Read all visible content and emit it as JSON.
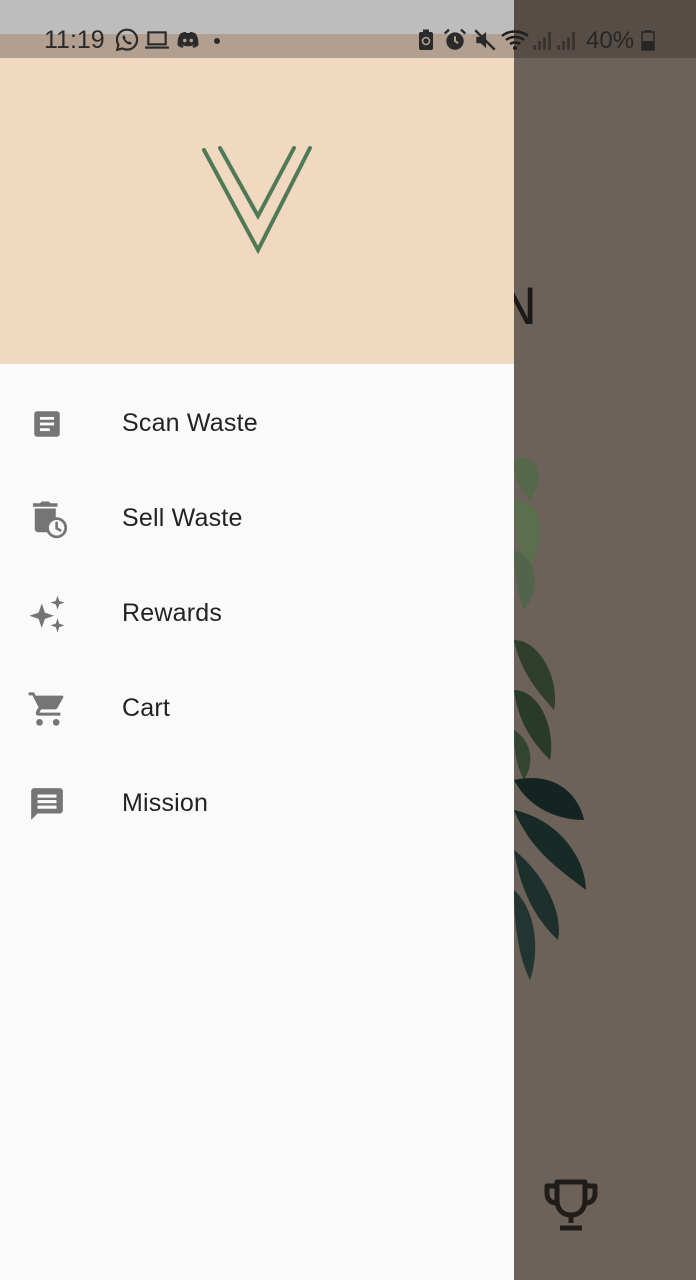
{
  "status_bar": {
    "time": "11:19",
    "battery_percent": "40%",
    "left_icons": [
      "whatsapp-icon",
      "laptop-icon",
      "discord-icon",
      "dot-icon"
    ],
    "right_icons": [
      "battery-saver-icon",
      "alarm-icon",
      "mute-icon",
      "wifi-icon",
      "signal-icon",
      "signal-icon",
      "battery-icon"
    ]
  },
  "drawer": {
    "logo": "v-logo",
    "header_color": "#f0d8c1",
    "items": [
      {
        "label": "Scan Waste",
        "icon": "article-icon"
      },
      {
        "label": "Sell Waste",
        "icon": "delete-clock-icon"
      },
      {
        "label": "Rewards",
        "icon": "sparkles-icon"
      },
      {
        "label": "Cart",
        "icon": "cart-icon"
      },
      {
        "label": "Mission",
        "icon": "message-icon"
      }
    ]
  },
  "background": {
    "overlay_color": "#6c6259",
    "bottom_icon": "trophy-icon"
  },
  "colors": {
    "logo_green": "#4f7a58",
    "icon_gray": "#757575",
    "text": "#232323"
  }
}
